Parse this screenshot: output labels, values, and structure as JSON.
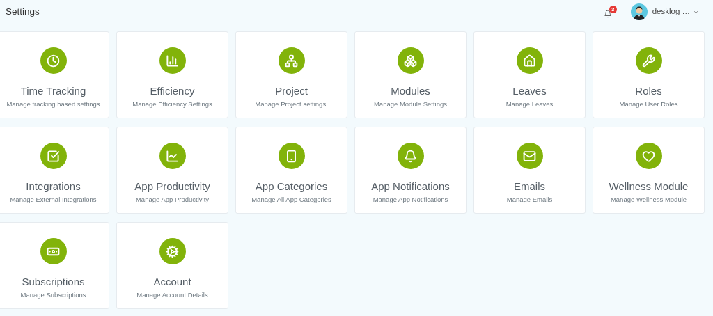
{
  "header": {
    "title": "Settings",
    "notifications": {
      "count": "3"
    },
    "user": {
      "name": "desklog …"
    }
  },
  "cards": [
    {
      "title": "Time Tracking",
      "subtitle": "Manage tracking based settings"
    },
    {
      "title": "Efficiency",
      "subtitle": "Manage Efficiency Settings"
    },
    {
      "title": "Project",
      "subtitle": "Manage Project settings."
    },
    {
      "title": "Modules",
      "subtitle": "Manage Module Settings"
    },
    {
      "title": "Leaves",
      "subtitle": "Manage Leaves"
    },
    {
      "title": "Roles",
      "subtitle": "Manage User Roles"
    },
    {
      "title": "Integrations",
      "subtitle": "Manage External Integrations"
    },
    {
      "title": "App Productivity",
      "subtitle": "Manage App Productivity"
    },
    {
      "title": "App Categories",
      "subtitle": "Manage All App Categories"
    },
    {
      "title": "App Notifications",
      "subtitle": "Manage App Notifications"
    },
    {
      "title": "Emails",
      "subtitle": "Manage Emails"
    },
    {
      "title": "Wellness Module",
      "subtitle": "Manage Wellness Module"
    },
    {
      "title": "Subscriptions",
      "subtitle": "Manage Subscriptions"
    },
    {
      "title": "Account",
      "subtitle": "Manage Account Details"
    }
  ]
}
